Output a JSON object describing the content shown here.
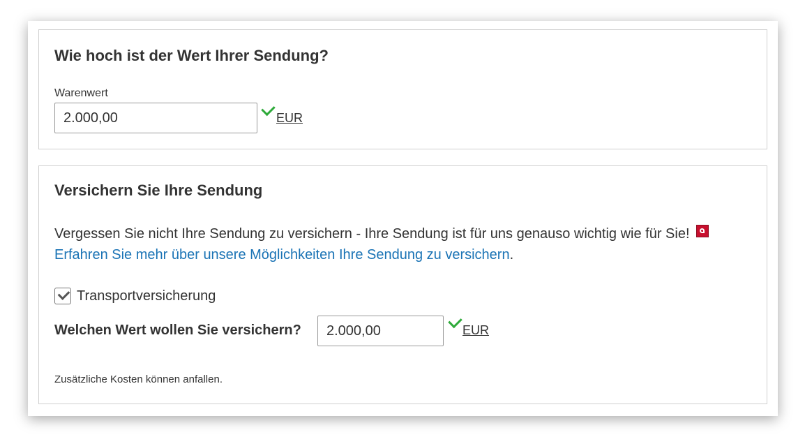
{
  "value_section": {
    "title": "Wie hoch ist der Wert Ihrer Sendung?",
    "field_label": "Warenwert",
    "field_value": "2.000,00",
    "unit": "EUR"
  },
  "insurance_section": {
    "title": "Versichern Sie Ihre Sendung",
    "description": "Vergessen Sie nicht Ihre Sendung zu versichern - Ihre Sendung ist für uns genauso wichtig wie für Sie!",
    "pdf_icon": "pdf-icon",
    "link_text": "Erfahren Sie mehr über unsere Möglichkeiten Ihre Sendung zu versichern",
    "link_suffix": ".",
    "checkbox_label": "Transportversicherung",
    "checkbox_checked": true,
    "question": "Welchen Wert wollen Sie versichern?",
    "insured_value": "2.000,00",
    "unit": "EUR",
    "note": "Zusätzliche Kosten können anfallen."
  },
  "colors": {
    "valid_check": "#2eaa3a",
    "link": "#1a73b5",
    "pdf_red": "#c8102e"
  }
}
